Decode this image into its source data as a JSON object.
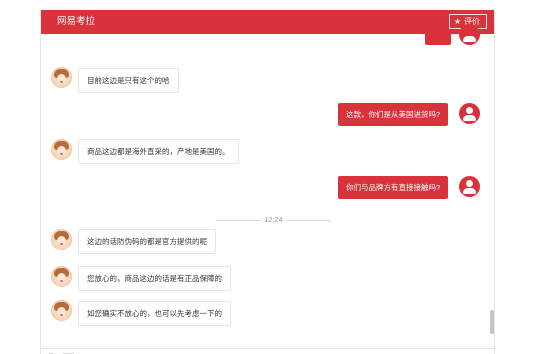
{
  "header": {
    "title": "网易考拉",
    "rate_button": {
      "icon": "star-icon",
      "label": "评价"
    }
  },
  "messages": [
    {
      "from": "agent",
      "text": "目前这边是只有这个的哈"
    },
    {
      "from": "user",
      "text": "这款，你们是从美国进货吗?"
    },
    {
      "from": "agent",
      "text": "商品这边都是海外直采的，产地是美国的。"
    },
    {
      "from": "user",
      "text": "你们与品牌方有直接接触吗?"
    },
    {
      "from": "agent",
      "text": "这边的话防伪码的都是官方提供的呢"
    },
    {
      "from": "agent",
      "text": "您放心的，商品这边的话是有正品保障的"
    },
    {
      "from": "agent",
      "text": "如您确实不放心的，也可以先考虑一下的"
    }
  ],
  "timestamp": "12:24",
  "toolbar": {
    "icons": [
      "emoji-icon",
      "image-icon",
      "folder-icon"
    ]
  },
  "colors": {
    "accent": "#d9323a",
    "agent_bubble_border": "#e6e6e6",
    "text": "#333333"
  }
}
